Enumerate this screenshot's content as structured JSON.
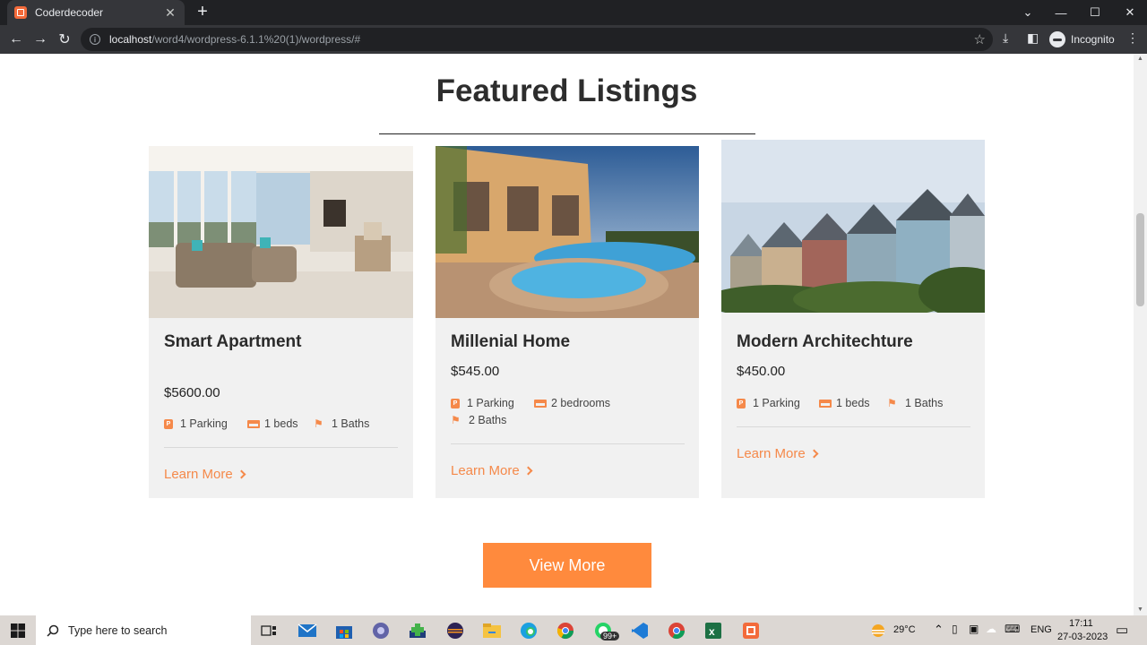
{
  "browser": {
    "tab_title": "Coderdecoder",
    "url_host": "localhost",
    "url_path": "/word4/wordpress-6.1.1%20(1)/wordpress/#",
    "profile_label": "Incognito"
  },
  "page": {
    "section_title": "Featured Listings",
    "view_more_label": "View More",
    "accent_color": "#ff8a3d"
  },
  "listings": [
    {
      "name": "Smart Apartment",
      "price": "$5600.00",
      "parking": "1 Parking",
      "beds": "1 beds",
      "baths": "1 Baths",
      "learn_more": "Learn More"
    },
    {
      "name": "Millenial Home",
      "price": "$545.00",
      "parking": "1 Parking",
      "beds": "2 bedrooms",
      "baths": "2 Baths",
      "learn_more": "Learn More"
    },
    {
      "name": "Modern Architechture",
      "price": "$450.00",
      "parking": "1 Parking",
      "beds": "1 beds",
      "baths": "1 Baths",
      "learn_more": "Learn More"
    }
  ],
  "taskbar": {
    "search_placeholder": "Type here to search",
    "temperature": "29°C",
    "language": "ENG",
    "time": "17:11",
    "date": "27-03-2023",
    "whatsapp_badge": "99+"
  }
}
